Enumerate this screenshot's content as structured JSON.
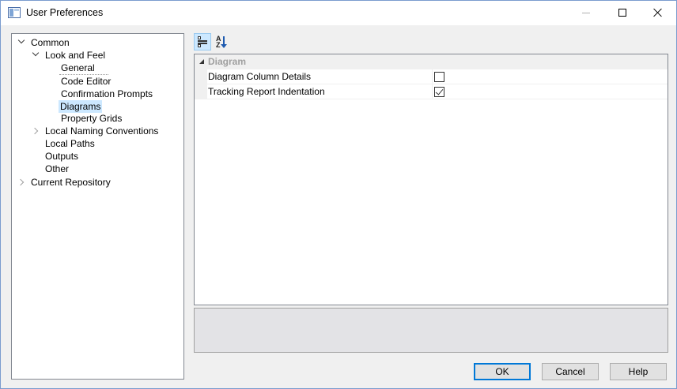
{
  "window": {
    "title": "User Preferences"
  },
  "tree": {
    "nodes": [
      {
        "label": "Common",
        "expanded": true
      },
      {
        "label": "Look and Feel",
        "expanded": true
      },
      {
        "label": "General"
      },
      {
        "label": "Code Editor"
      },
      {
        "label": "Confirmation Prompts"
      },
      {
        "label": "Diagrams",
        "selected": true
      },
      {
        "label": "Property Grids"
      },
      {
        "label": "Local Naming Conventions",
        "expanded": false
      },
      {
        "label": "Local Paths"
      },
      {
        "label": "Outputs"
      },
      {
        "label": "Other"
      },
      {
        "label": "Current Repository",
        "expanded": false
      }
    ]
  },
  "toolbar": {
    "categorized_icon": "categorized-icon",
    "alphabetical_icon": "sort-alphabetical-icon",
    "active": "categorized"
  },
  "property_grid": {
    "category": "Diagram",
    "properties": [
      {
        "name": "Diagram Column Details",
        "checked": false
      },
      {
        "name": "Tracking Report Indentation",
        "checked": true
      }
    ]
  },
  "buttons": {
    "ok": "OK",
    "cancel": "Cancel",
    "help": "Help"
  },
  "colors": {
    "selection": "#cce8ff",
    "default_button_border": "#0078d7"
  }
}
